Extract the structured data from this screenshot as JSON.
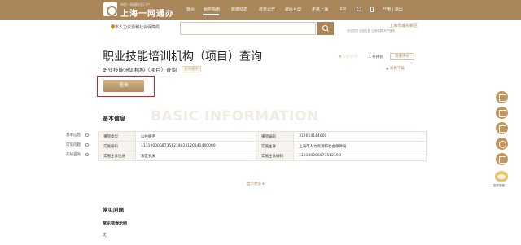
{
  "header": {
    "logo_sub": "市民一网通办总门户",
    "logo_main": "上海一网通办",
    "nav": [
      "首页",
      "服务指南",
      "数据动态",
      "政务公开",
      "政民互动",
      "走进上海",
      "EN"
    ],
    "user": "**用 | 退出"
  },
  "search": {
    "location": "市人力资源和社会保障局",
    "placeholder": "",
    "district": "上海市浦东新区",
    "district_sub": "测试测试  当前位置  住房保障  开户服务"
  },
  "page": {
    "title": "职业技能培训机构（项目）查询",
    "subtitle": "职业技能培训机构（项目）查询",
    "tag": "查询服务",
    "stars": "★☆☆☆☆",
    "rating_text": "1 条评价",
    "rate_button": "我要评价",
    "download": "▲ 表格下载",
    "query_button": "查询"
  },
  "basic_info": {
    "title": "基本信息",
    "watermark": "BASIC INFORMATION",
    "rows": [
      [
        "事项类型",
        "公共服务",
        "事项编码",
        "312014144000"
      ],
      [
        "实施编码",
        "11310000687351219023120141440000",
        "实施主体",
        "上海市人力资源和社会保障局"
      ],
      [
        "实施主体性质",
        "法定机关",
        "实施主体编码",
        "11310000687351219O"
      ]
    ],
    "more": "显示更多 ▾"
  },
  "side_nav": [
    "基本信息",
    "常见问题",
    "在线咨询"
  ],
  "faq": {
    "title": "常见问题",
    "question": "常见错误示例",
    "answer": "无"
  },
  "float": {
    "mascot_label": "智能客服"
  }
}
